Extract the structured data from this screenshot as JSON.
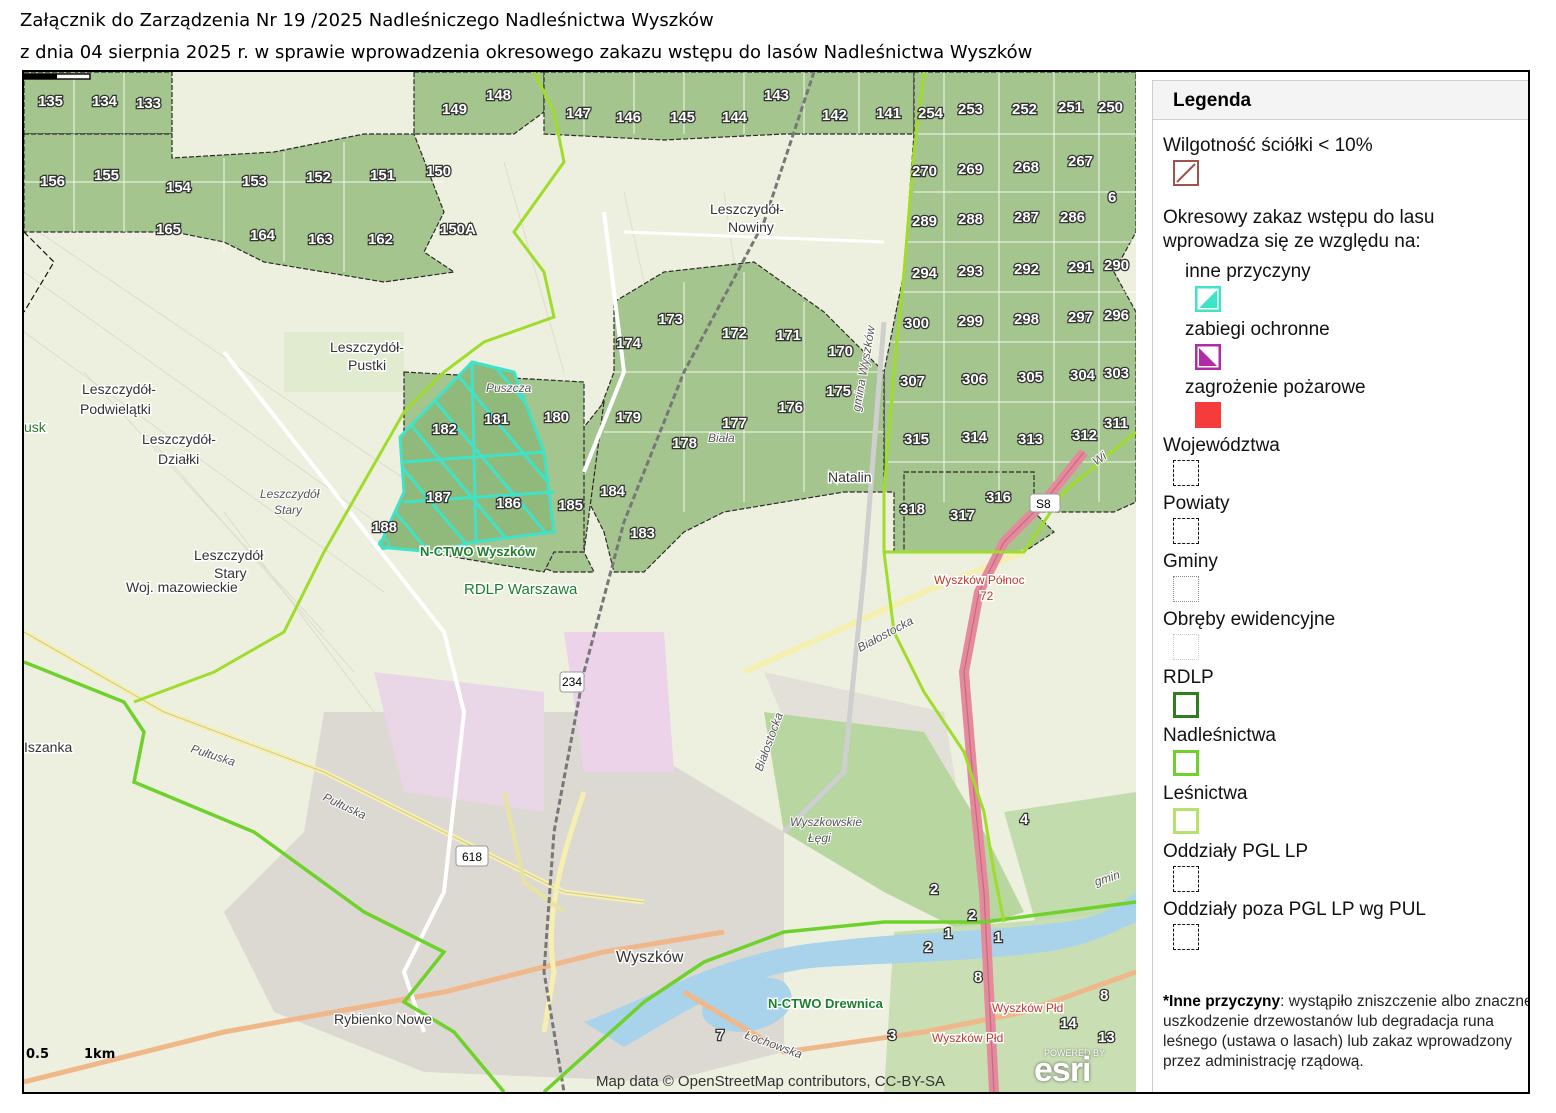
{
  "header": {
    "line1": "Załącznik do  Zarządzenia Nr 19 /2025 Nadleśniczego Nadleśnictwa Wyszków",
    "line2": "z dnia 04 sierpnia 2025 r. w sprawie wprowadzenia okresowego zakazu wstępu do lasów Nadleśnictwa Wyszków"
  },
  "map": {
    "credit": "Map data © OpenStreetMap contributors, CC-BY-SA",
    "esri_logo": "esri",
    "powered_by": "POWERED BY",
    "scale_labels": [
      "0.5",
      "1km"
    ],
    "place_labels": {
      "leszczydol_nowiny": [
        "Leszczydół-",
        "Nowiny"
      ],
      "leszczydol_pustki": [
        "Leszczydół-",
        "Pustki"
      ],
      "leszczydol_podwielatki": [
        "Leszczydół-",
        "Podwielątki"
      ],
      "leszczydol_dzialki": [
        "Leszczydół-",
        "Działki"
      ],
      "leszczydol_stary_italic": [
        "Leszczydół",
        "Stary"
      ],
      "leszczydol_stary": [
        "Leszczydół",
        "Stary"
      ],
      "woj": "Woj. mazowieckie",
      "usk": "usk",
      "iszanka": "Iszanka",
      "rdlp": "RDLP Warszawa",
      "nctwo_wyszkow": "N-CTWO Wyszków",
      "nctwo_drewnica": "N-CTWO Drewnica",
      "natalin": "Natalin",
      "wyszkow": "Wyszków",
      "rybienko": "Rybienko Nowe",
      "wyszkowskie_legi": [
        "Wyszkowskie",
        "Łęgi"
      ],
      "wyszkow_polnoc": [
        "Wyszków Północ",
        "72"
      ],
      "wyszkow_p2": "Wyszków Płd",
      "wyszkow_p3": "Wyszków Płd",
      "s8": "S8",
      "r618": "618",
      "r234": "234",
      "pultuska1": "Pułtuska",
      "pultuska2": "Pułtuska",
      "bialostocka1": "Białostocka",
      "bialostocka2": "Białostocka",
      "lochowska": "Łochowska",
      "gmina": "gmina Wyszków",
      "puszcza": "Puszcza",
      "biala": "Biała",
      "gmin": "gmin",
      "wiol": "Wi"
    },
    "compartments": [
      "135",
      "134",
      "133",
      "149",
      "148",
      "147",
      "146",
      "145",
      "144",
      "143",
      "142",
      "141",
      "254",
      "253",
      "252",
      "251",
      "250",
      "156",
      "155",
      "154",
      "153",
      "152",
      "151",
      "150",
      "270",
      "269",
      "268",
      "267",
      "6",
      "165",
      "164",
      "163",
      "162",
      "150A",
      "289",
      "288",
      "287",
      "286",
      "294",
      "293",
      "292",
      "291",
      "290",
      "173",
      "172",
      "171",
      "174",
      "170",
      "300",
      "299",
      "298",
      "297",
      "296",
      "175",
      "307",
      "306",
      "305",
      "304",
      "303",
      "182",
      "181",
      "180",
      "179",
      "177",
      "176",
      "178",
      "315",
      "314",
      "313",
      "312",
      "311",
      "187",
      "186",
      "185",
      "184",
      "183",
      "188",
      "318",
      "317",
      "316",
      "2",
      "3",
      "4",
      "7",
      "8",
      "2",
      "8",
      "14",
      "13",
      "1",
      "2",
      "1"
    ],
    "hatched_compartments_note": ""
  },
  "legend": {
    "title": "Legenda",
    "items": [
      {
        "label": "Wilgotność ściółki < 10%",
        "symbol": "diagonal-hatch-brown"
      },
      {
        "label": "Okresowy zakaz wstępu do lasu",
        "symbol": ""
      },
      {
        "label": "wprowadza się ze względu na:",
        "symbol": ""
      },
      {
        "label": "inne przyczyny",
        "symbol": "cyan-hatch"
      },
      {
        "label": "zabiegi ochronne",
        "symbol": "magenta-hatch"
      },
      {
        "label": "zagrożenie pożarowe",
        "symbol": "red-fill"
      },
      {
        "label": "Województwa",
        "symbol": "dashed-black"
      },
      {
        "label": "Powiaty",
        "symbol": "dashed-black"
      },
      {
        "label": "Gminy",
        "symbol": "dotted-grey"
      },
      {
        "label": "Obręby ewidencyjne",
        "symbol": "dotted-light"
      },
      {
        "label": "RDLP",
        "symbol": "dark-green-box"
      },
      {
        "label": "Nadleśnictwa",
        "symbol": "green-box"
      },
      {
        "label": "Leśnictwa",
        "symbol": "light-green-box"
      },
      {
        "label": "Oddziały PGL LP",
        "symbol": "dashed-black-box"
      },
      {
        "label": "Oddziały poza PGL LP wg PUL",
        "symbol": "dashed-black-box"
      }
    ],
    "footnote_bold": "*Inne przyczyny",
    "footnote_text": ": wystąpiło zniszczenie albo znaczne uszkodzenie drzewostanów lub degradacja runa leśnego (ustawa o lasach) lub zakaz wprowadzony przez administrację rządową."
  },
  "colors": {
    "forest": "#a5c58f",
    "background": "#eef0df",
    "nadlesnictwo_border": "#6fd12b",
    "lesnictwo_border": "#9fdc2b",
    "hatched_zone": "#3fe3c8",
    "s8_road": "#e48a9c",
    "river": "#a8d3ea",
    "urban": "#d9d6cf"
  }
}
